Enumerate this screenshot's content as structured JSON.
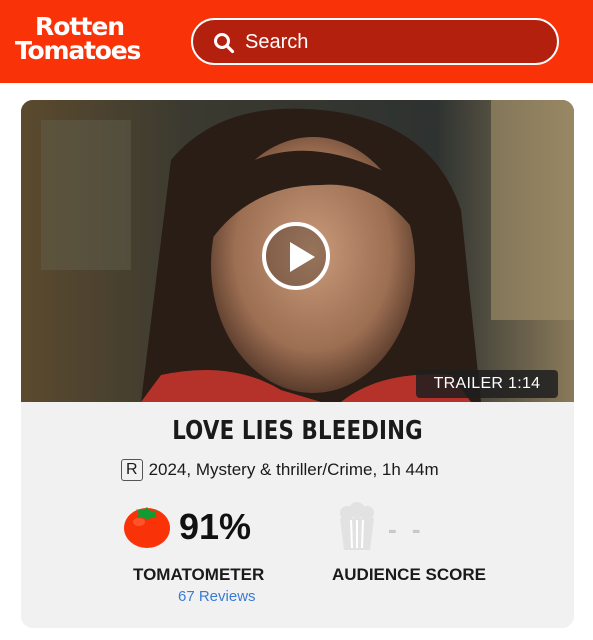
{
  "header": {
    "logo_line1": "Rotten",
    "logo_line2": "Tomatoes",
    "search_placeholder": "Search",
    "brand_color": "#f93208"
  },
  "media": {
    "trailer_label": "TRAILER 1:14",
    "play_icon": "play-icon"
  },
  "movie": {
    "title": "LOVE LIES BLEEDING",
    "rating": "R",
    "details": "2024, Mystery & thriller/Crime, 1h 44m"
  },
  "scores": {
    "tomatometer_value": "91%",
    "tomatometer_label": "TOMATOMETER",
    "reviews_link": "67 Reviews",
    "audience_value": "- -",
    "audience_label": "AUDIENCE SCORE",
    "tomato_icon": "tomato-icon",
    "popcorn_icon": "popcorn-icon"
  }
}
